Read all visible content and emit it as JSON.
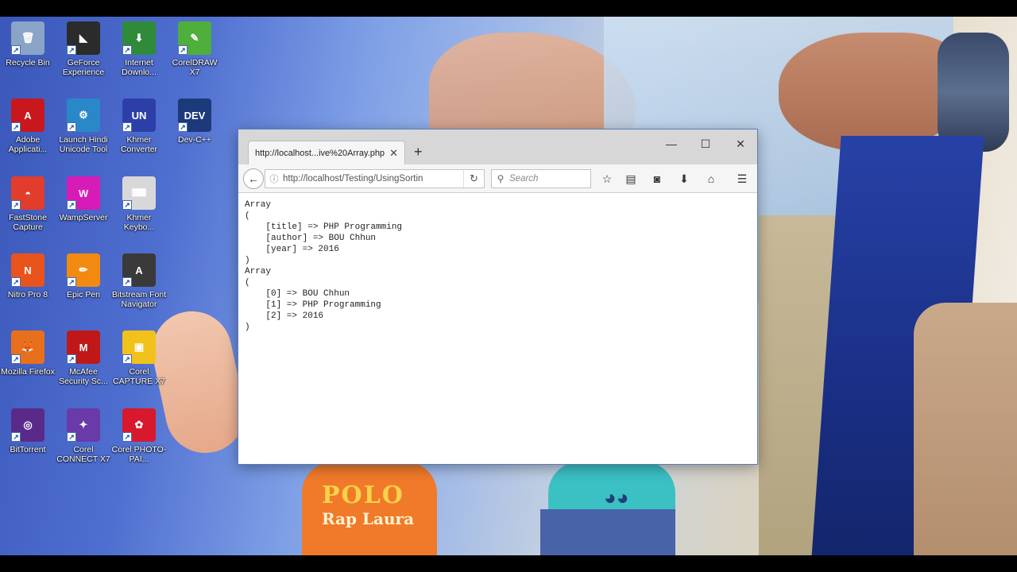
{
  "desktop": {
    "icons": [
      {
        "label": "Recycle Bin",
        "icon": "recycle-bin-icon",
        "color": "#8aa4c8",
        "glyph": "🗑"
      },
      {
        "label": "GeForce Experience",
        "icon": "geforce-icon",
        "color": "#2b2b2b",
        "glyph": "◣"
      },
      {
        "label": "Internet Downlo...",
        "icon": "internet-download-manager-icon",
        "color": "#2f8a3a",
        "glyph": "⬇"
      },
      {
        "label": "CorelDRAW X7",
        "icon": "coreldraw-icon",
        "color": "#4fae3c",
        "glyph": "✎"
      },
      {
        "label": "Adobe Applicati...",
        "icon": "adobe-icon",
        "color": "#c8181e",
        "glyph": "A"
      },
      {
        "label": "Launch Hindi Unicode Tool",
        "icon": "hindi-unicode-icon",
        "color": "#2a88c8",
        "glyph": "⚙"
      },
      {
        "label": "Khmer Converter",
        "icon": "khmer-converter-icon",
        "color": "#2c3fa8",
        "glyph": "UN"
      },
      {
        "label": "Dev-C++",
        "icon": "devcpp-icon",
        "color": "#1c3a7a",
        "glyph": "DEV"
      },
      {
        "label": "FastStone Capture",
        "icon": "faststone-icon",
        "color": "#e23c2c",
        "glyph": "◓"
      },
      {
        "label": "WampServer",
        "icon": "wampserver-icon",
        "color": "#d61bb7",
        "glyph": "W"
      },
      {
        "label": "Khmer Keybo...",
        "icon": "khmer-keyboard-icon",
        "color": "#d8d8d8",
        "glyph": "⌨"
      },
      {
        "label": "Nitro Pro 8",
        "icon": "nitro-icon",
        "color": "#e8541c",
        "glyph": "N"
      },
      {
        "label": "Epic Pen",
        "icon": "epic-pen-icon",
        "color": "#f28a12",
        "glyph": "✏"
      },
      {
        "label": "Bitstream Font Navigator",
        "icon": "bitstream-icon",
        "color": "#3a3a3a",
        "glyph": "A"
      },
      {
        "label": "Mozilla Firefox",
        "icon": "firefox-icon",
        "color": "#e8701c",
        "glyph": "🦊"
      },
      {
        "label": "McAfee Security Sc...",
        "icon": "mcafee-icon",
        "color": "#c01818",
        "glyph": "M"
      },
      {
        "label": "Corel CAPTURE X7",
        "icon": "corel-capture-icon",
        "color": "#f2c21c",
        "glyph": "▣"
      },
      {
        "label": "BitTorrent",
        "icon": "bittorrent-icon",
        "color": "#5a2a8a",
        "glyph": "◎"
      },
      {
        "label": "Corel CONNECT X7",
        "icon": "corel-connect-icon",
        "color": "#6a3aa8",
        "glyph": "✦"
      },
      {
        "label": "Corel PHOTO-PAI...",
        "icon": "corel-photopaint-icon",
        "color": "#d8182c",
        "glyph": "✿"
      }
    ],
    "wallpaper": {
      "shirt_text": "POLO",
      "shirt_subtext": "Rap Laura"
    }
  },
  "browser": {
    "tab_title": "http://localhost...ive%20Array.php",
    "url": "http://localhost/Testing/UsingSortin",
    "search_placeholder": "Search",
    "page_text": "Array\n(\n    [title] => PHP Programming\n    [author] => BOU Chhun\n    [year] => 2016\n)\nArray\n(\n    [0] => BOU Chhun\n    [1] => PHP Programming\n    [2] => 2016\n)"
  }
}
